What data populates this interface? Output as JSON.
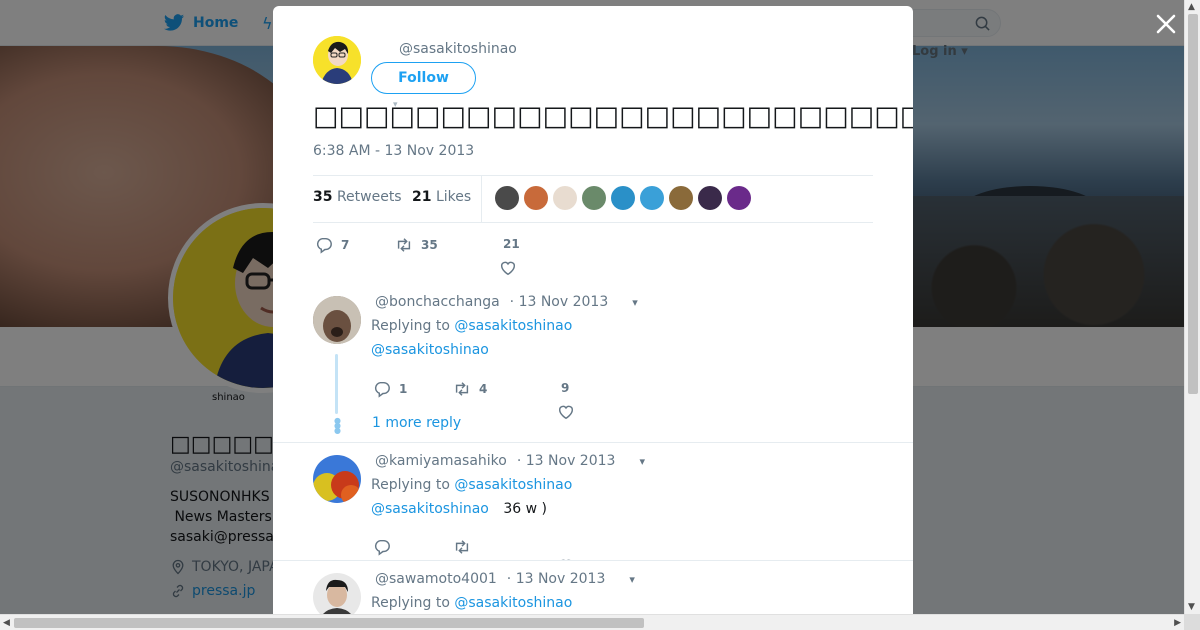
{
  "header": {
    "home_label": "Home",
    "login_label": "Log in"
  },
  "profile": {
    "name": "□□□□□",
    "handle": "@sasakitoshina",
    "avatar_caption": "shinao",
    "bio": "SUSONONHKS\n News Masters\nsasaki@pressa",
    "location": "TOKYO, JAPA",
    "website": "pressa.jp"
  },
  "tweet": {
    "handle": "@sasakitoshinao",
    "follow_label": "Follow",
    "text": "□□□□□□□□□□□□□□□□□□□□□□□□□□□□□□□□□□□□□□□□□□□□□□□□□□□□Tw□□□□□□□□□□□□□□□□□□□□",
    "time": "6:38 AM - 13 Nov 2013",
    "retweets_count": "35",
    "retweets_label": "Retweets",
    "likes_count": "21",
    "likes_label": "Likes",
    "reply_count": "7",
    "retweet_count": "35",
    "like_count": "21",
    "liker_colors": [
      "#4a4a4a",
      "#c86a3a",
      "#e8dcd0",
      "#6a8a6a",
      "#2a90c8",
      "#3aa0d8",
      "#8a6a3a",
      "#3a2a4a",
      "#6a2a8a"
    ]
  },
  "replies": [
    {
      "handle": "@bonchacchanga",
      "date": "· 13 Nov 2013",
      "replying_prefix": "Replying to",
      "replying_to": "@sasakitoshinao",
      "mention": "@sasakitoshinao",
      "body": "",
      "reply_count": "1",
      "retweet_count": "4",
      "like_count": "9",
      "more_replies": "1 more reply"
    },
    {
      "handle": "@kamiyamasahiko",
      "date": "· 13 Nov 2013",
      "replying_prefix": "Replying to",
      "replying_to": "@sasakitoshinao",
      "mention": "@sasakitoshinao",
      "body": "36 w )",
      "reply_count": "",
      "retweet_count": "",
      "like_count": ""
    },
    {
      "handle": "@sawamoto4001",
      "date": "· 13 Nov 2013",
      "replying_prefix": "Replying to",
      "replying_to": "@sasakitoshinao"
    }
  ],
  "colors": {
    "accent": "#1da1f2",
    "link": "#1b95e0",
    "muted": "#657786"
  }
}
